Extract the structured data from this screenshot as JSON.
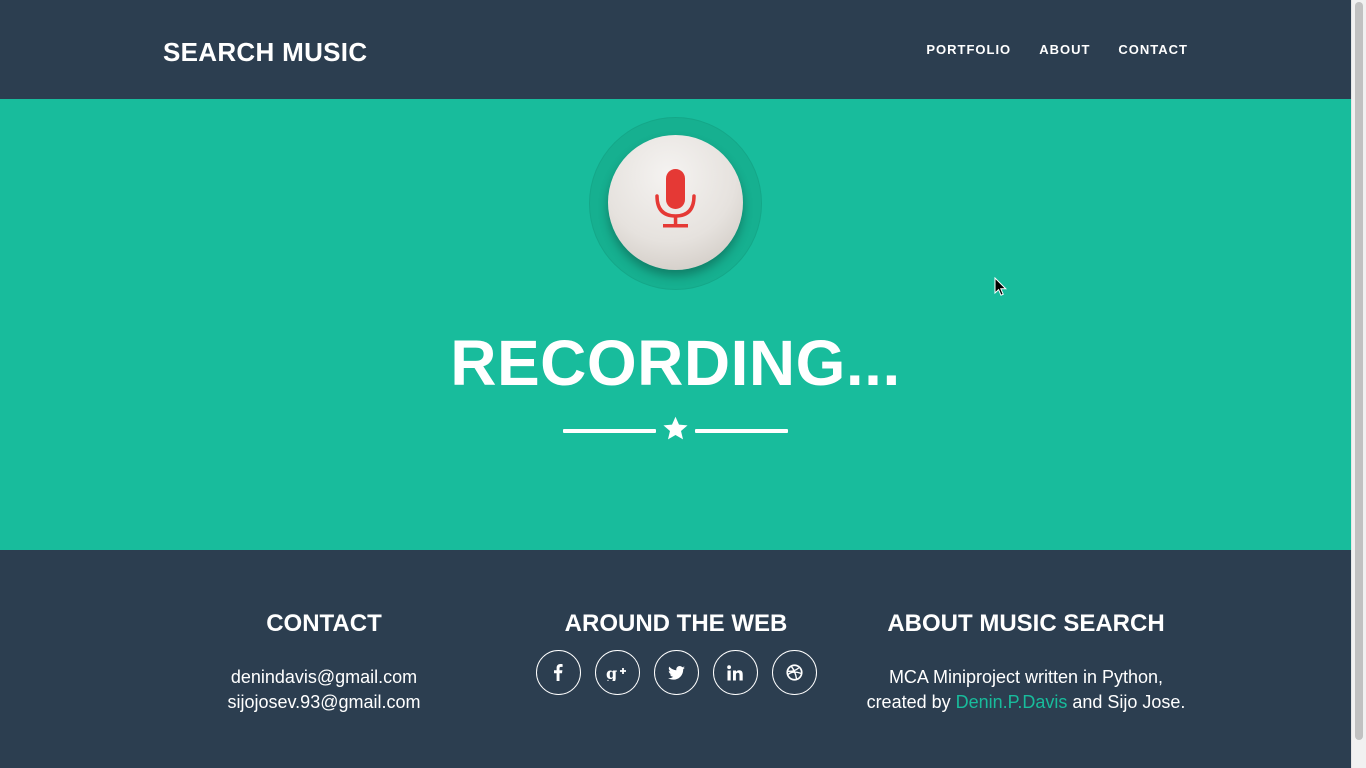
{
  "navbar": {
    "brand": "SEARCH MUSIC",
    "links": [
      "PORTFOLIO",
      "ABOUT",
      "CONTACT"
    ]
  },
  "hero": {
    "mic_icon": "microphone-icon",
    "status_text": "RECORDING...",
    "divider_icon": "star-icon"
  },
  "footer": {
    "contact": {
      "heading": "CONTACT",
      "email1": "denindavis@gmail.com",
      "email2": "sijojosev.93@gmail.com"
    },
    "web": {
      "heading": "AROUND THE WEB",
      "icons": [
        "facebook-icon",
        "google-plus-icon",
        "twitter-icon",
        "linkedin-icon",
        "dribbble-icon"
      ]
    },
    "about": {
      "heading": "ABOUT MUSIC SEARCH",
      "line1": "MCA Miniproject written in Python,",
      "line2_prefix": "created by ",
      "author_link": "Denin.P.Davis",
      "line2_suffix": " and Sijo Jose."
    }
  },
  "colors": {
    "navy": "#2c3e50",
    "teal": "#18bc9c",
    "mic_red": "#e53935"
  }
}
